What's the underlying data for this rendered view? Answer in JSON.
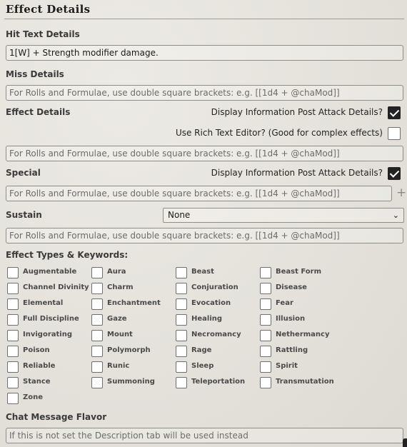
{
  "section": {
    "title": "Effect Details"
  },
  "hit": {
    "label": "Hit Text Details",
    "value": "1[W] + Strength modifier damage."
  },
  "miss": {
    "label": "Miss Details",
    "placeholder": "For Rolls and Formulae, use double square brackets: e.g. [[1d4 + @chaMod]]"
  },
  "effect": {
    "label": "Effect Details",
    "post_attack_label": "Display Information Post Attack Details?",
    "post_attack_checked": true,
    "rich_text_label": "Use Rich Text Editor? (Good for complex effects)",
    "rich_text_checked": false,
    "placeholder": "For Rolls and Formulae, use double square brackets: e.g. [[1d4 + @chaMod]]"
  },
  "special": {
    "label": "Special",
    "post_attack_label": "Display Information Post Attack Details?",
    "post_attack_checked": true,
    "placeholder": "For Rolls and Formulae, use double square brackets: e.g. [[1d4 + @chaMod]]",
    "add_symbol": "+"
  },
  "sustain": {
    "label": "Sustain",
    "selected": "None",
    "placeholder": "For Rolls and Formulae, use double square brackets: e.g. [[1d4 + @chaMod]]"
  },
  "keywords": {
    "label": "Effect Types & Keywords:",
    "items": [
      "Augmentable",
      "Aura",
      "Beast",
      "Beast Form",
      "Channel Divinity",
      "Charm",
      "Conjuration",
      "Disease",
      "Elemental",
      "Enchantment",
      "Evocation",
      "Fear",
      "Full Discipline",
      "Gaze",
      "Healing",
      "Illusion",
      "Invigorating",
      "Mount",
      "Necromancy",
      "Nethermancy",
      "Poison",
      "Polymorph",
      "Rage",
      "Rattling",
      "Reliable",
      "Runic",
      "Sleep",
      "Spirit",
      "Stance",
      "Summoning",
      "Teleportation",
      "Transmutation",
      "Zone"
    ]
  },
  "flavor": {
    "label": "Chat Message Flavor",
    "placeholder": "If this is not set the Description tab will be used instead"
  },
  "icons": {
    "check": "checkmark-icon",
    "add": "plus-icon",
    "dropdown": "chevron-down-icon"
  }
}
